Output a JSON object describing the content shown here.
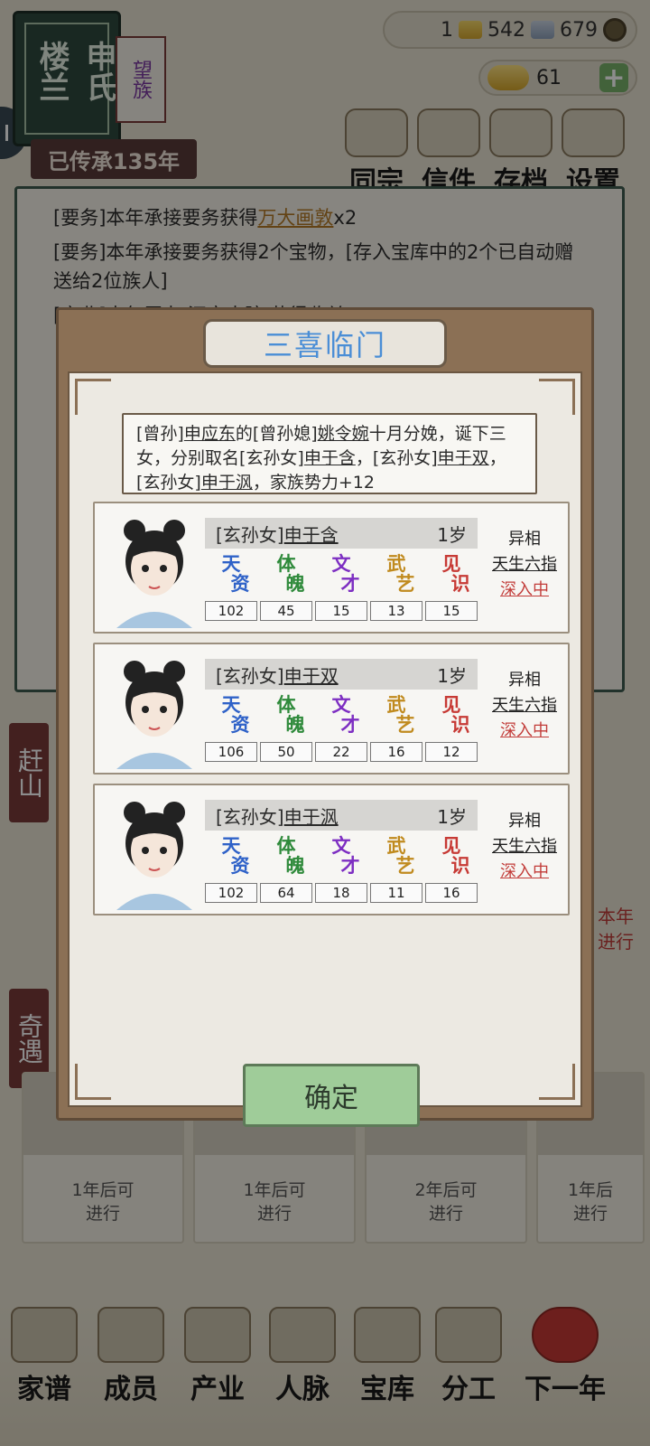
{
  "clan": {
    "name": "楼兰",
    "surname": "申氏",
    "tag": "望族",
    "legacy": "已传承135年"
  },
  "resources": {
    "gold_prefix": "1",
    "gold_count": "542",
    "silver_count": "679",
    "ingots": "61"
  },
  "top_nav": [
    {
      "label": "同宗"
    },
    {
      "label": "信件"
    },
    {
      "label": "存档"
    },
    {
      "label": "设置"
    }
  ],
  "log": [
    {
      "prefix": "[要务]本年承接要务获得",
      "highlight": "万大画敦",
      "suffix": "x2"
    },
    {
      "text": "[要务]本年承接要务获得2个宝物，[存入宝库中的2个已自动赠送给2位族人]"
    },
    {
      "text": "[产业]本年置办 深宅大院 获得收益"
    }
  ],
  "side_tabs": [
    "赶山",
    "奇遇"
  ],
  "bg_cards": [
    {
      "text": "1年后可\n进行"
    },
    {
      "text": "1年后可\n进行"
    },
    {
      "text": "2年后可\n进行"
    },
    {
      "text": "1年后\n进行"
    }
  ],
  "bg_right_note": "本年\n进行",
  "bottom_nav": [
    {
      "label": "家谱"
    },
    {
      "label": "成员"
    },
    {
      "label": "产业"
    },
    {
      "label": "人脉"
    },
    {
      "label": "宝库"
    },
    {
      "label": "分工"
    },
    {
      "label": "下一年"
    }
  ],
  "modal": {
    "title": "三喜临门",
    "summary": {
      "p1": "[曾孙]",
      "n1": "申应东",
      "p2": "的[曾孙媳]",
      "n2": "姚令婉",
      "p3": "十月分娩，诞下三女，分别取名[玄孙女]",
      "n3": "申于含",
      "p4": "，[玄孙女]",
      "n4": "申于双",
      "p5": "，[玄孙女]",
      "n5": "申于沨",
      "p6": "，家族势力+12"
    },
    "stat_labels": [
      {
        "a": "天",
        "b": "资"
      },
      {
        "a": "体",
        "b": "魄"
      },
      {
        "a": "文",
        "b": "才"
      },
      {
        "a": "武",
        "b": "艺"
      },
      {
        "a": "见",
        "b": "识"
      }
    ],
    "children": [
      {
        "title": "[玄孙女]",
        "name": "申于含",
        "age": "1岁",
        "stats": [
          102,
          45,
          15,
          13,
          15
        ],
        "trait_title": "异相",
        "trait": "天生六指",
        "action": "深入中"
      },
      {
        "title": "[玄孙女]",
        "name": "申于双",
        "age": "1岁",
        "stats": [
          106,
          50,
          22,
          16,
          12
        ],
        "trait_title": "异相",
        "trait": "天生六指",
        "action": "深入中"
      },
      {
        "title": "[玄孙女]",
        "name": "申于沨",
        "age": "1岁",
        "stats": [
          102,
          64,
          18,
          11,
          16
        ],
        "trait_title": "异相",
        "trait": "天生六指",
        "action": "深入中"
      }
    ],
    "confirm": "确定"
  },
  "colors": {
    "tianzi": "#2f62c8",
    "tipo": "#2f8a3b",
    "wencai": "#7d2ec2",
    "wuyi": "#c08a1e",
    "jianshi": "#c73a35",
    "modal_frame": "#8b7055",
    "confirm_bg": "#9fcc99"
  }
}
